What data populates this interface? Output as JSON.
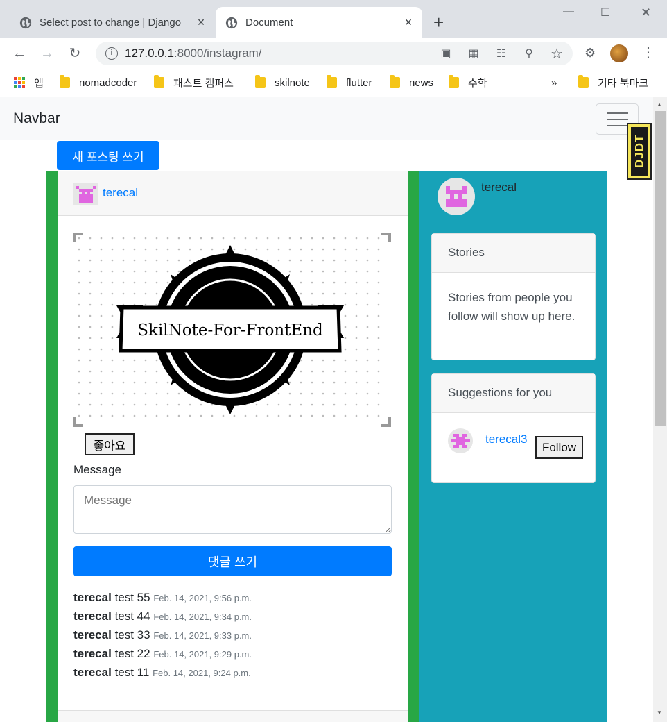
{
  "browser": {
    "tabs": [
      {
        "title": "Select post to change | Django",
        "close": "×",
        "active": false
      },
      {
        "title": "Document",
        "close": "×",
        "active": true
      }
    ],
    "new_tab": "+",
    "url_host": "127.0.0.1",
    "url_rest": ":8000/instagram/",
    "bookmarks": [
      "앱",
      "nomadcoder",
      "패스트 캠퍼스",
      "skilnote",
      "flutter",
      "news",
      "수학"
    ],
    "bookmarks_overflow": "»",
    "other_bookmarks": "기타 북마크"
  },
  "navbar": {
    "brand": "Navbar"
  },
  "new_post_button": "새 포스팅 쓰기",
  "post": {
    "author": "terecal",
    "image_text": "SkilNote-For-FrontEnd",
    "like_label": "좋아요",
    "message_label": "Message",
    "message_placeholder": "Message",
    "submit_label": "댓글 쓰기",
    "comments": [
      {
        "author": "terecal",
        "text": "test 55",
        "time": "Feb. 14, 2021, 9:56 p.m."
      },
      {
        "author": "terecal",
        "text": "test 44",
        "time": "Feb. 14, 2021, 9:34 p.m."
      },
      {
        "author": "terecal",
        "text": "test 33",
        "time": "Feb. 14, 2021, 9:33 p.m."
      },
      {
        "author": "terecal",
        "text": "test 22",
        "time": "Feb. 14, 2021, 9:29 p.m."
      },
      {
        "author": "terecal",
        "text": "test 11",
        "time": "Feb. 14, 2021, 9:24 p.m."
      }
    ]
  },
  "sidebar": {
    "username": "terecal",
    "stories_title": "Stories",
    "stories_text": "Stories from people you follow will show up here.",
    "suggestions_title": "Suggestions for you",
    "suggestion": {
      "name": "terecal3",
      "follow_label": "Follow"
    }
  },
  "debug_toolbar": "DJDT",
  "colors": {
    "primary": "#007bff",
    "left_column": "#28a745",
    "right_column": "#17a2b8",
    "avatar_pink": "#e066e0"
  }
}
